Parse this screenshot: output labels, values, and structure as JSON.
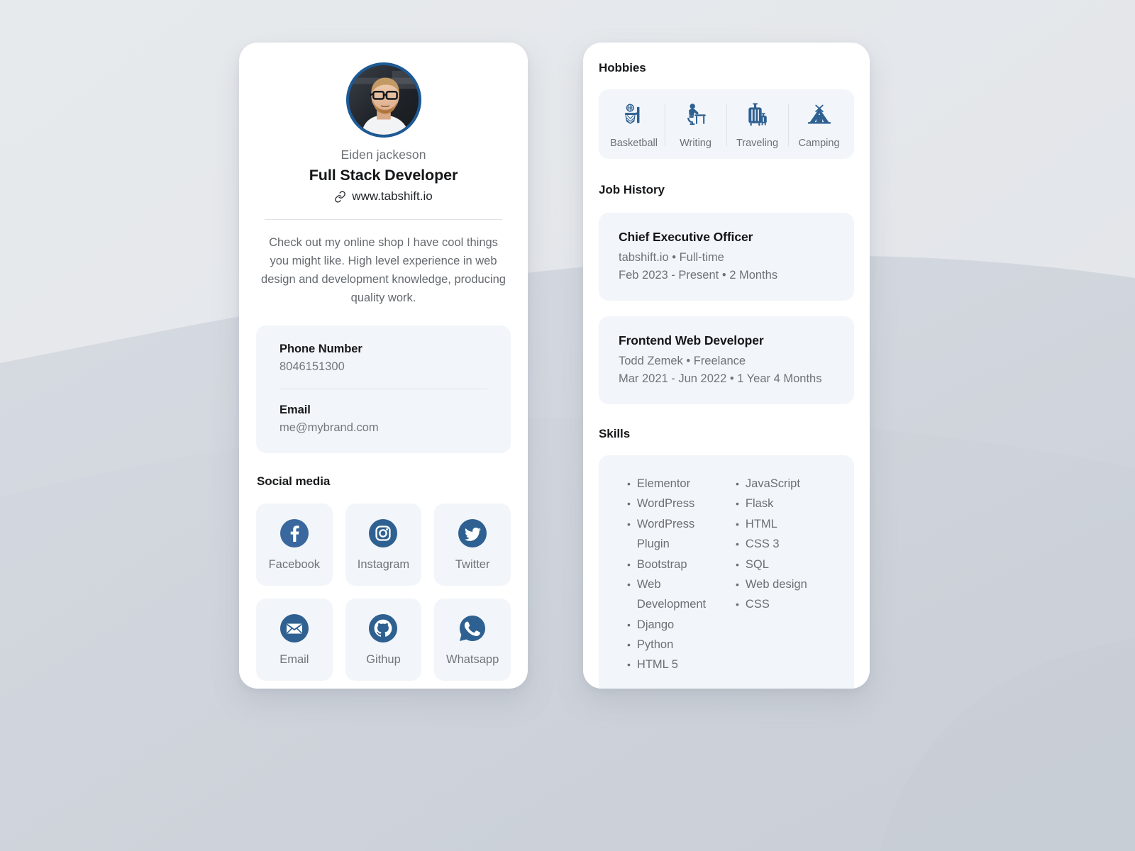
{
  "theme": {
    "accent": "#1d5a95",
    "social_icon_color": "#2e6091",
    "panel_bg": "#f2f5f9",
    "card_bg": "#ffffff",
    "page_bg": "#e2e5e9",
    "muted_text": "#6f7377",
    "heading_text": "#141618"
  },
  "profile": {
    "avatar_alt": "profile-photo",
    "name": "Eiden jackeson",
    "role": "Full Stack Developer",
    "website": "www.tabshift.io",
    "link_icon": "link-icon",
    "bio": "Check out my online shop I have cool things you might like. High level experience in web design and development knowledge, producing quality work."
  },
  "contact": {
    "fields": [
      {
        "label": "Phone Number",
        "value": "8046151300"
      },
      {
        "label": "Email",
        "value": "me@mybrand.com"
      }
    ]
  },
  "social": {
    "title": "Social media",
    "items": [
      {
        "label": "Facebook",
        "icon": "facebook-icon"
      },
      {
        "label": "Instagram",
        "icon": "instagram-icon"
      },
      {
        "label": "Twitter",
        "icon": "twitter-icon"
      },
      {
        "label": "Email",
        "icon": "envelope-icon"
      },
      {
        "label": "Githup",
        "icon": "github-icon"
      },
      {
        "label": "Whatsapp",
        "icon": "whatsapp-icon"
      }
    ]
  },
  "hobbies": {
    "title": "Hobbies",
    "items": [
      {
        "label": "Basketball",
        "icon": "basketball-hoop-icon"
      },
      {
        "label": "Writing",
        "icon": "person-writing-desk-icon"
      },
      {
        "label": "Traveling",
        "icon": "luggage-icon"
      },
      {
        "label": "Camping",
        "icon": "tent-icon"
      }
    ]
  },
  "job_history": {
    "title": "Job History",
    "items": [
      {
        "title": "Chief Executive Officer",
        "company_line": "tabshift.io • Full-time",
        "date_line": "Feb 2023 - Present • 2 Months"
      },
      {
        "title": "Frontend Web Developer",
        "company_line": "Todd Zemek • Freelance",
        "date_line": "Mar 2021 - Jun 2022 • 1 Year 4 Months"
      }
    ]
  },
  "skills": {
    "title": "Skills",
    "bullet": "•",
    "column_left": [
      "Elementor",
      "WordPress",
      "WordPress Plugin",
      "Bootstrap",
      "Web Development",
      "Django",
      "Python",
      "HTML 5"
    ],
    "column_right": [
      "JavaScript",
      "Flask",
      "HTML",
      "CSS 3",
      "SQL",
      "Web design",
      "CSS"
    ]
  }
}
